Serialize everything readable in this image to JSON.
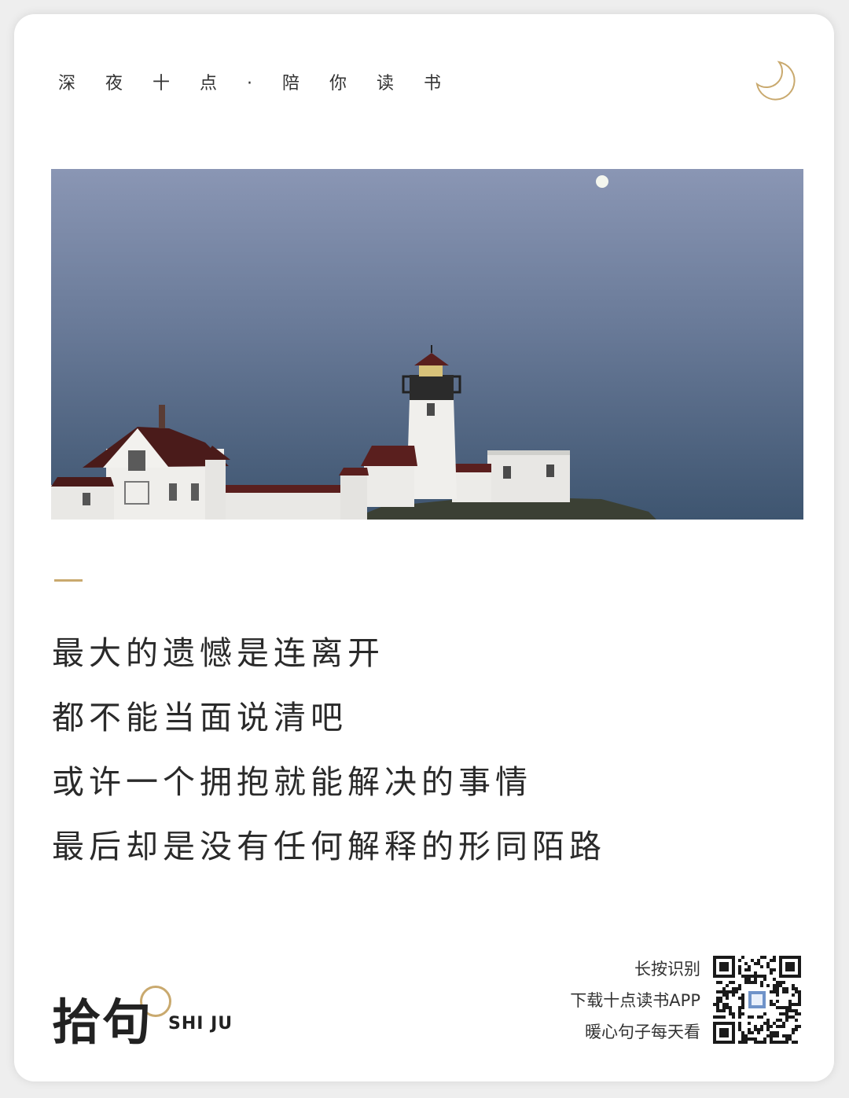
{
  "header": {
    "tagline": "深夜十点·陪你读书",
    "moon_icon": "crescent-moon-icon"
  },
  "photo": {
    "description_icon": "lighthouse-photo"
  },
  "quote": {
    "lines": [
      "最大的遗憾是连离开",
      "都不能当面说清吧",
      "或许一个拥抱就能解决的事情",
      "最后却是没有任何解释的形同陌路"
    ]
  },
  "footer": {
    "brand_cn": "拾句",
    "brand_en": "SHI JU",
    "cta": [
      "长按识别",
      "下载十点读书APP",
      "暖心句子每天看"
    ]
  },
  "colors": {
    "accent": "#c9a96e",
    "text": "#2a2a2a",
    "card": "#ffffff"
  }
}
